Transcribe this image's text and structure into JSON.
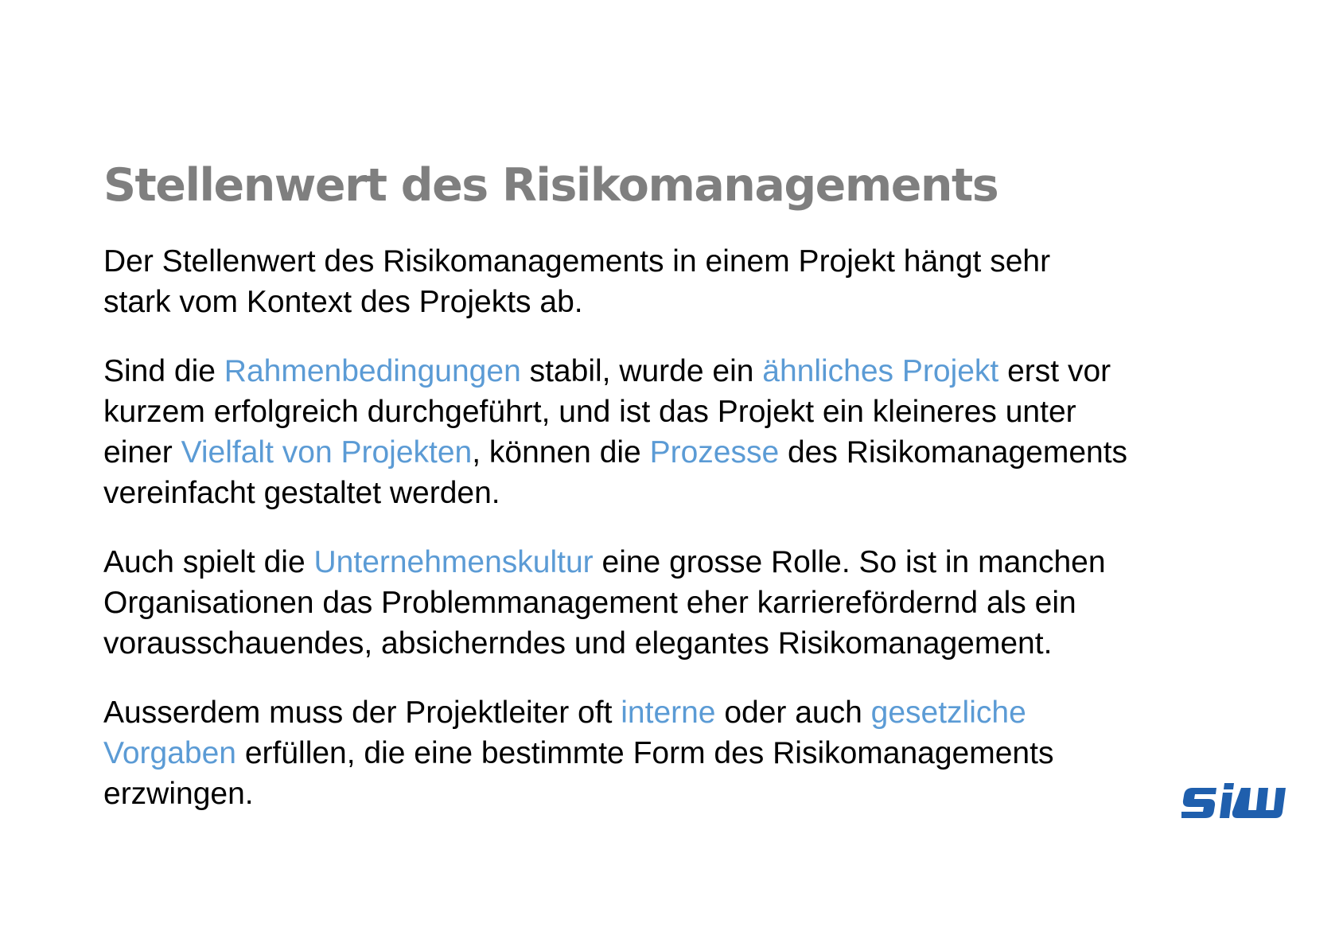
{
  "slide": {
    "title": "Stellenwert des Risikomanagements",
    "paragraphs": [
      {
        "segments": [
          {
            "text": "Der Stellenwert des Risikomanagements in einem Projekt hängt sehr",
            "highlight": false
          },
          {
            "text": "stark vom Kontext des Projekts ab.",
            "highlight": false,
            "break_before": true
          }
        ]
      },
      {
        "segments": [
          {
            "text": "Sind die ",
            "highlight": false
          },
          {
            "text": "Rahmenbedingungen",
            "highlight": true
          },
          {
            "text": " stabil, wurde ein ",
            "highlight": false
          },
          {
            "text": "ähnliches Projekt",
            "highlight": true
          },
          {
            "text": " erst vor",
            "highlight": false
          },
          {
            "text": "kurzem erfolgreich durchgeführt, und ist das Projekt ein kleineres unter",
            "highlight": false,
            "break_before": true
          },
          {
            "text": "einer ",
            "highlight": false,
            "break_before": true
          },
          {
            "text": "Vielfalt von Projekten",
            "highlight": true
          },
          {
            "text": ", können die ",
            "highlight": false
          },
          {
            "text": "Prozesse",
            "highlight": true
          },
          {
            "text": " des Risikomanagements",
            "highlight": false
          },
          {
            "text": "vereinfacht gestaltet werden.",
            "highlight": false,
            "break_before": true
          }
        ]
      },
      {
        "segments": [
          {
            "text": "Auch spielt die ",
            "highlight": false
          },
          {
            "text": "Unternehmenskultur",
            "highlight": true
          },
          {
            "text": " eine grosse Rolle. So ist in manchen",
            "highlight": false
          },
          {
            "text": "Organisationen das Problemmanagement eher karrierefördernd als ein",
            "highlight": false,
            "break_before": true
          },
          {
            "text": "vorausschauendes, absicherndes und elegantes Risikomanagement.",
            "highlight": false,
            "break_before": true
          }
        ]
      },
      {
        "segments": [
          {
            "text": "Ausserdem muss der Projektleiter oft ",
            "highlight": false
          },
          {
            "text": "interne",
            "highlight": true
          },
          {
            "text": " oder auch ",
            "highlight": false
          },
          {
            "text": "gesetzliche",
            "highlight": true
          },
          {
            "text": "Vorgaben",
            "highlight": true,
            "break_before": true
          },
          {
            "text": " erfüllen, die eine bestimmte Form des Risikomanagements",
            "highlight": false
          },
          {
            "text": "erzwingen.",
            "highlight": false,
            "break_before": true
          }
        ]
      }
    ],
    "logo": {
      "text": "SIW",
      "color": "#1f5fad"
    },
    "colors": {
      "title": "#7f7f7f",
      "body": "#000000",
      "highlight": "#5b9bd5"
    }
  }
}
